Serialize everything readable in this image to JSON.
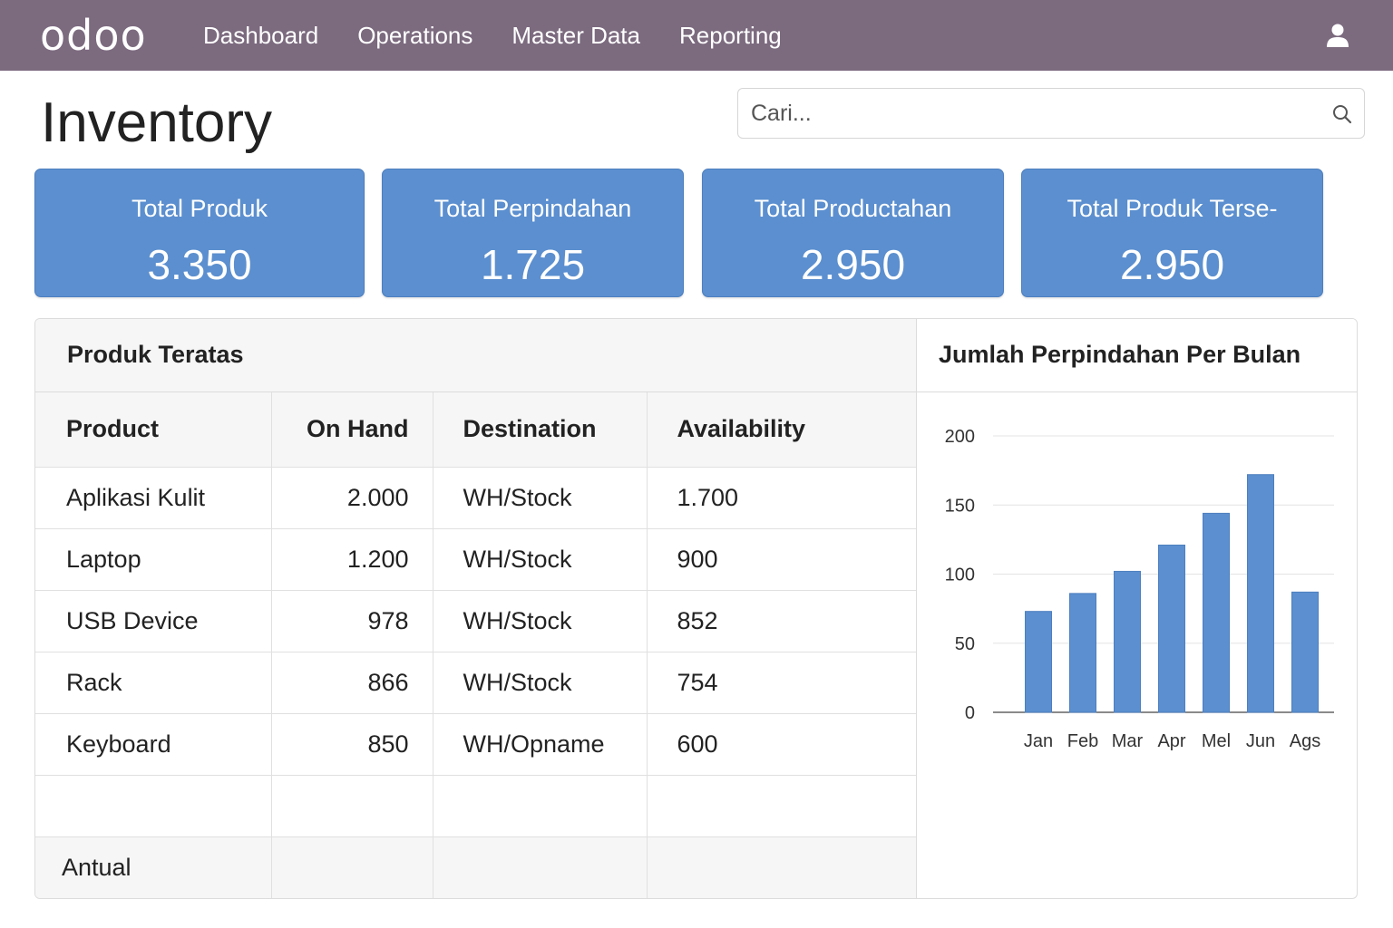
{
  "app": {
    "logo": "odoo",
    "nav": [
      "Dashboard",
      "Operations",
      "Master Data",
      "Reporting"
    ],
    "page_title": "Inventory"
  },
  "search": {
    "placeholder": "Cari..."
  },
  "cards": [
    {
      "label": "Total Produk",
      "value": "3.350"
    },
    {
      "label": "Total Perpindahan",
      "value": "1.725"
    },
    {
      "label": "Total Productahan",
      "value": "2.950"
    },
    {
      "label": "Total Produk Terse-",
      "value": "2.950"
    }
  ],
  "table": {
    "title": "Produk Teratas",
    "headers": [
      "Product",
      "On Hand",
      "Destination",
      "Availability"
    ],
    "rows": [
      [
        "Aplikasi Kulit",
        "2.000",
        "WH/Stock",
        "1.700"
      ],
      [
        "Laptop",
        "1.200",
        "WH/Stock",
        "900"
      ],
      [
        "USB Device",
        "978",
        "WH/Stock",
        "852"
      ],
      [
        "Rack",
        "866",
        "WH/Stock",
        "754"
      ],
      [
        "Keyboard",
        "850",
        "WH/Opname",
        "600"
      ]
    ],
    "footer_label": "Antual"
  },
  "chart_data": {
    "type": "bar",
    "title": "Jumlah Perpindahan Per Bulan",
    "categories": [
      "Jan",
      "Feb",
      "Mar",
      "Apr",
      "Mel",
      "Jun",
      "Ags"
    ],
    "values": [
      73,
      86,
      102,
      121,
      144,
      172,
      87
    ],
    "ylim": [
      0,
      200
    ],
    "yticks": [
      0,
      50,
      100,
      150,
      200
    ],
    "grid": true,
    "bar_color": "#5b8fcf"
  },
  "colors": {
    "topbar": "#7c6a7f",
    "card": "#5b8fcf"
  }
}
